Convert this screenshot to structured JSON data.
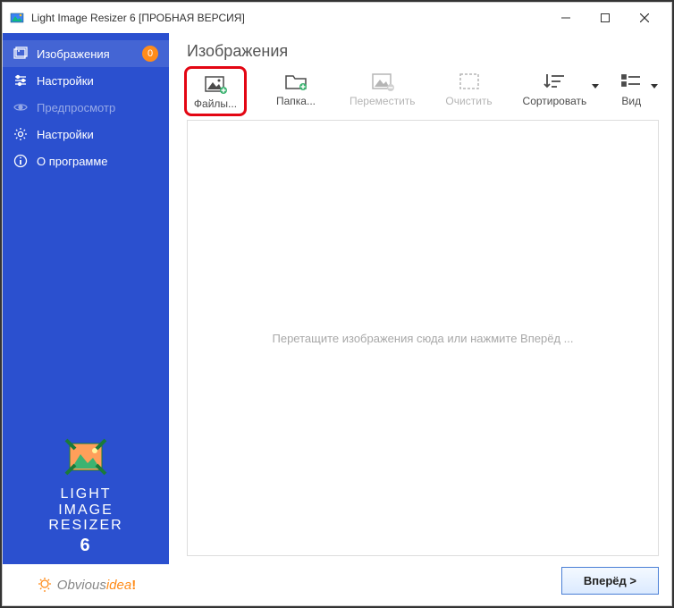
{
  "titlebar": {
    "title": "Light Image Resizer 6  [ПРОБНАЯ ВЕРСИЯ]"
  },
  "sidebar": {
    "items": [
      {
        "label": "Изображения",
        "badge": "0"
      },
      {
        "label": "Настройки"
      },
      {
        "label": "Предпросмотр"
      },
      {
        "label": "Настройки"
      },
      {
        "label": "О программе"
      }
    ],
    "brand": {
      "line1": "LIGHT",
      "line2": "IMAGE",
      "line3": "RESIZER",
      "version": "6"
    },
    "footer": {
      "text_main": "Obvious",
      "text_accent": "idea",
      "excl": "!"
    }
  },
  "main": {
    "title": "Изображения",
    "toolbar": {
      "files": "Файлы...",
      "folder": "Папка...",
      "move": "Переместить",
      "clear": "Очистить",
      "sort": "Сортировать",
      "view": "Вид"
    },
    "dropzone_hint": "Перетащите изображения сюда или нажмите Вперёд ...",
    "next_button": "Вперёд >"
  }
}
